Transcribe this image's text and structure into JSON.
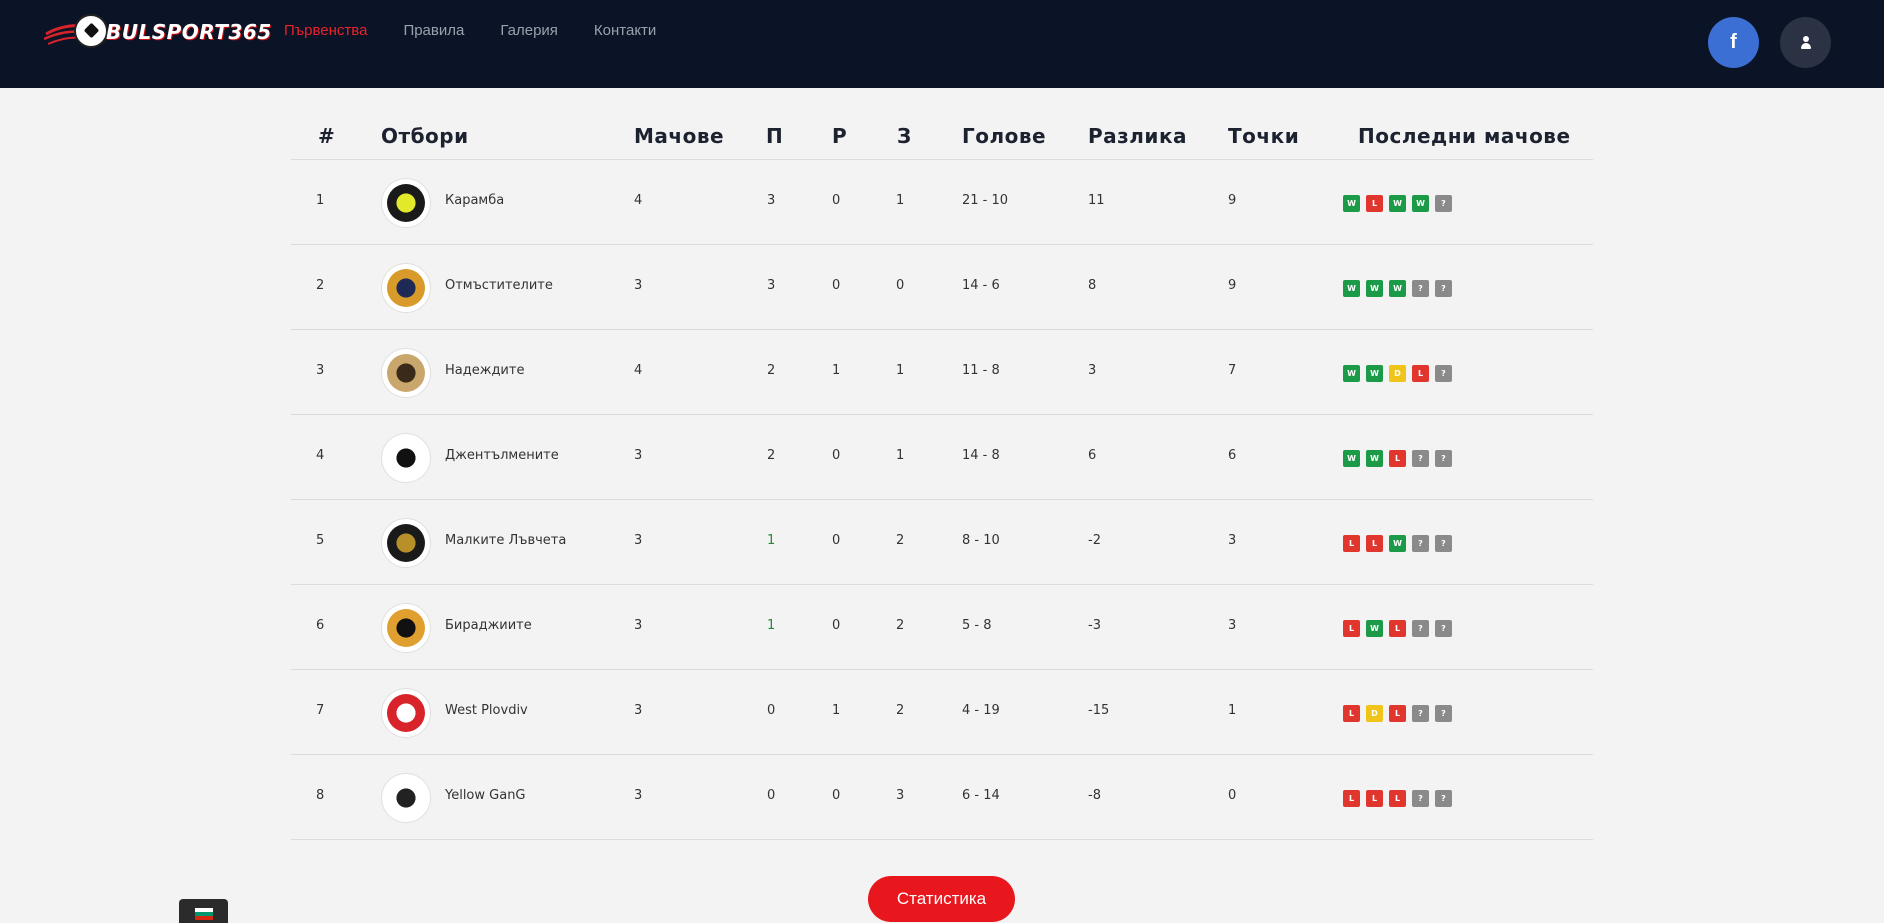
{
  "header": {
    "logo_text": "BULSPORT365",
    "nav": [
      {
        "label": "Първенства",
        "active": true
      },
      {
        "label": "Правила",
        "active": false
      },
      {
        "label": "Галерия",
        "active": false
      },
      {
        "label": "Контакти",
        "active": false
      }
    ],
    "facebook_label": "f"
  },
  "table": {
    "headers": [
      "#",
      "Отбори",
      "Мачове",
      "П",
      "Р",
      "З",
      "Голове",
      "Разлика",
      "Точки",
      "Последни мачове"
    ],
    "rows": [
      {
        "pos": "1",
        "team": "Карамба",
        "played": "4",
        "w": "3",
        "d": "0",
        "l": "1",
        "goals": "21 - 10",
        "diff": "11",
        "pts": "9",
        "form": [
          "W",
          "L",
          "W",
          "W",
          "?"
        ],
        "logo_color": "#1a1a1a",
        "logo_accent": "#e2e82a"
      },
      {
        "pos": "2",
        "team": "Отмъстителите",
        "played": "3",
        "w": "3",
        "d": "0",
        "l": "0",
        "goals": "14 - 6",
        "diff": "8",
        "pts": "9",
        "form": [
          "W",
          "W",
          "W",
          "?",
          "?"
        ],
        "logo_color": "#d89a2a",
        "logo_accent": "#1e2a55"
      },
      {
        "pos": "3",
        "team": "Надеждите",
        "played": "4",
        "w": "2",
        "d": "1",
        "l": "1",
        "goals": "11 - 8",
        "diff": "3",
        "pts": "7",
        "form": [
          "W",
          "W",
          "D",
          "L",
          "?"
        ],
        "logo_color": "#c9a66b",
        "logo_accent": "#3a2a1a"
      },
      {
        "pos": "4",
        "team": "Джентълмените",
        "played": "3",
        "w": "2",
        "d": "0",
        "l": "1",
        "goals": "14 - 8",
        "diff": "6",
        "pts": "6",
        "form": [
          "W",
          "W",
          "L",
          "?",
          "?"
        ],
        "logo_color": "#ffffff",
        "logo_accent": "#111111"
      },
      {
        "pos": "5",
        "team": "Малките Лъвчета",
        "played": "3",
        "w": "1",
        "d": "0",
        "l": "2",
        "goals": "8 - 10",
        "diff": "-2",
        "pts": "3",
        "form": [
          "L",
          "L",
          "W",
          "?",
          "?"
        ],
        "logo_color": "#1a1a1a",
        "logo_accent": "#b8902a"
      },
      {
        "pos": "6",
        "team": "Бираджиите",
        "played": "3",
        "w": "1",
        "d": "0",
        "l": "2",
        "goals": "5 - 8",
        "diff": "-3",
        "pts": "3",
        "form": [
          "L",
          "W",
          "L",
          "?",
          "?"
        ],
        "logo_color": "#e0a030",
        "logo_accent": "#111111"
      },
      {
        "pos": "7",
        "team": "West Plovdiv",
        "played": "3",
        "w": "0",
        "d": "1",
        "l": "2",
        "goals": "4 - 19",
        "diff": "-15",
        "pts": "1",
        "form": [
          "L",
          "D",
          "L",
          "?",
          "?"
        ],
        "logo_color": "#d8232a",
        "logo_accent": "#ffffff"
      },
      {
        "pos": "8",
        "team": "Yellow GanG",
        "played": "3",
        "w": "0",
        "d": "0",
        "l": "3",
        "goals": "6 - 14",
        "diff": "-8",
        "pts": "0",
        "form": [
          "L",
          "L",
          "L",
          "?",
          "?"
        ],
        "logo_color": "#ffffff",
        "logo_accent": "#222222"
      }
    ]
  },
  "stats_button": "Статистика",
  "colors": {
    "header_bg": "#0b1326",
    "accent_red": "#e8171e",
    "win": "#1b9b48",
    "loss": "#e0362e",
    "draw": "#f0c419",
    "unknown": "#8a8a8a"
  }
}
